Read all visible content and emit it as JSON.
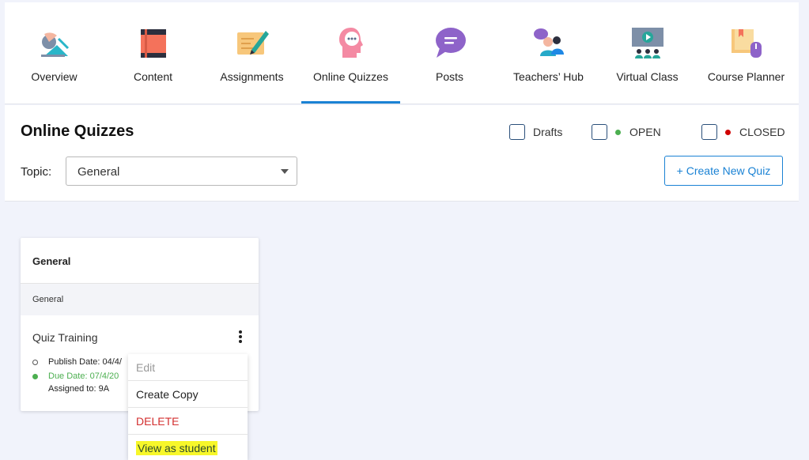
{
  "nav": {
    "items": [
      {
        "label": "Overview",
        "icon": "overview-icon"
      },
      {
        "label": "Content",
        "icon": "book-icon"
      },
      {
        "label": "Assignments",
        "icon": "assignment-icon"
      },
      {
        "label": "Online Quizzes",
        "icon": "quiz-head-icon"
      },
      {
        "label": "Posts",
        "icon": "chat-bubble-icon"
      },
      {
        "label": "Teachers’ Hub",
        "icon": "teachers-hub-icon"
      },
      {
        "label": "Virtual Class",
        "icon": "virtual-class-icon"
      },
      {
        "label": "Course Planner",
        "icon": "course-planner-icon"
      }
    ],
    "active_index": 3,
    "accent_color": "#1a82d4"
  },
  "header": {
    "title": "Online Quizzes",
    "filters": {
      "drafts": "Drafts",
      "open": "OPEN",
      "closed": "CLOSED",
      "open_color": "#4caf50",
      "closed_color": "#d00000"
    },
    "topic_label": "Topic:",
    "topic_value": "General",
    "create_button": "+ Create New Quiz"
  },
  "card": {
    "title": "General",
    "subtitle": "General",
    "quiz_name": "Quiz Training",
    "publish_date": "Publish Date: 04/4/",
    "due_date": "Due Date: 07/4/20",
    "assigned_to": "Assigned to: 9A"
  },
  "menu": {
    "edit": "Edit",
    "create_copy": "Create Copy",
    "delete": "DELETE",
    "view_as_student": "View as student"
  }
}
